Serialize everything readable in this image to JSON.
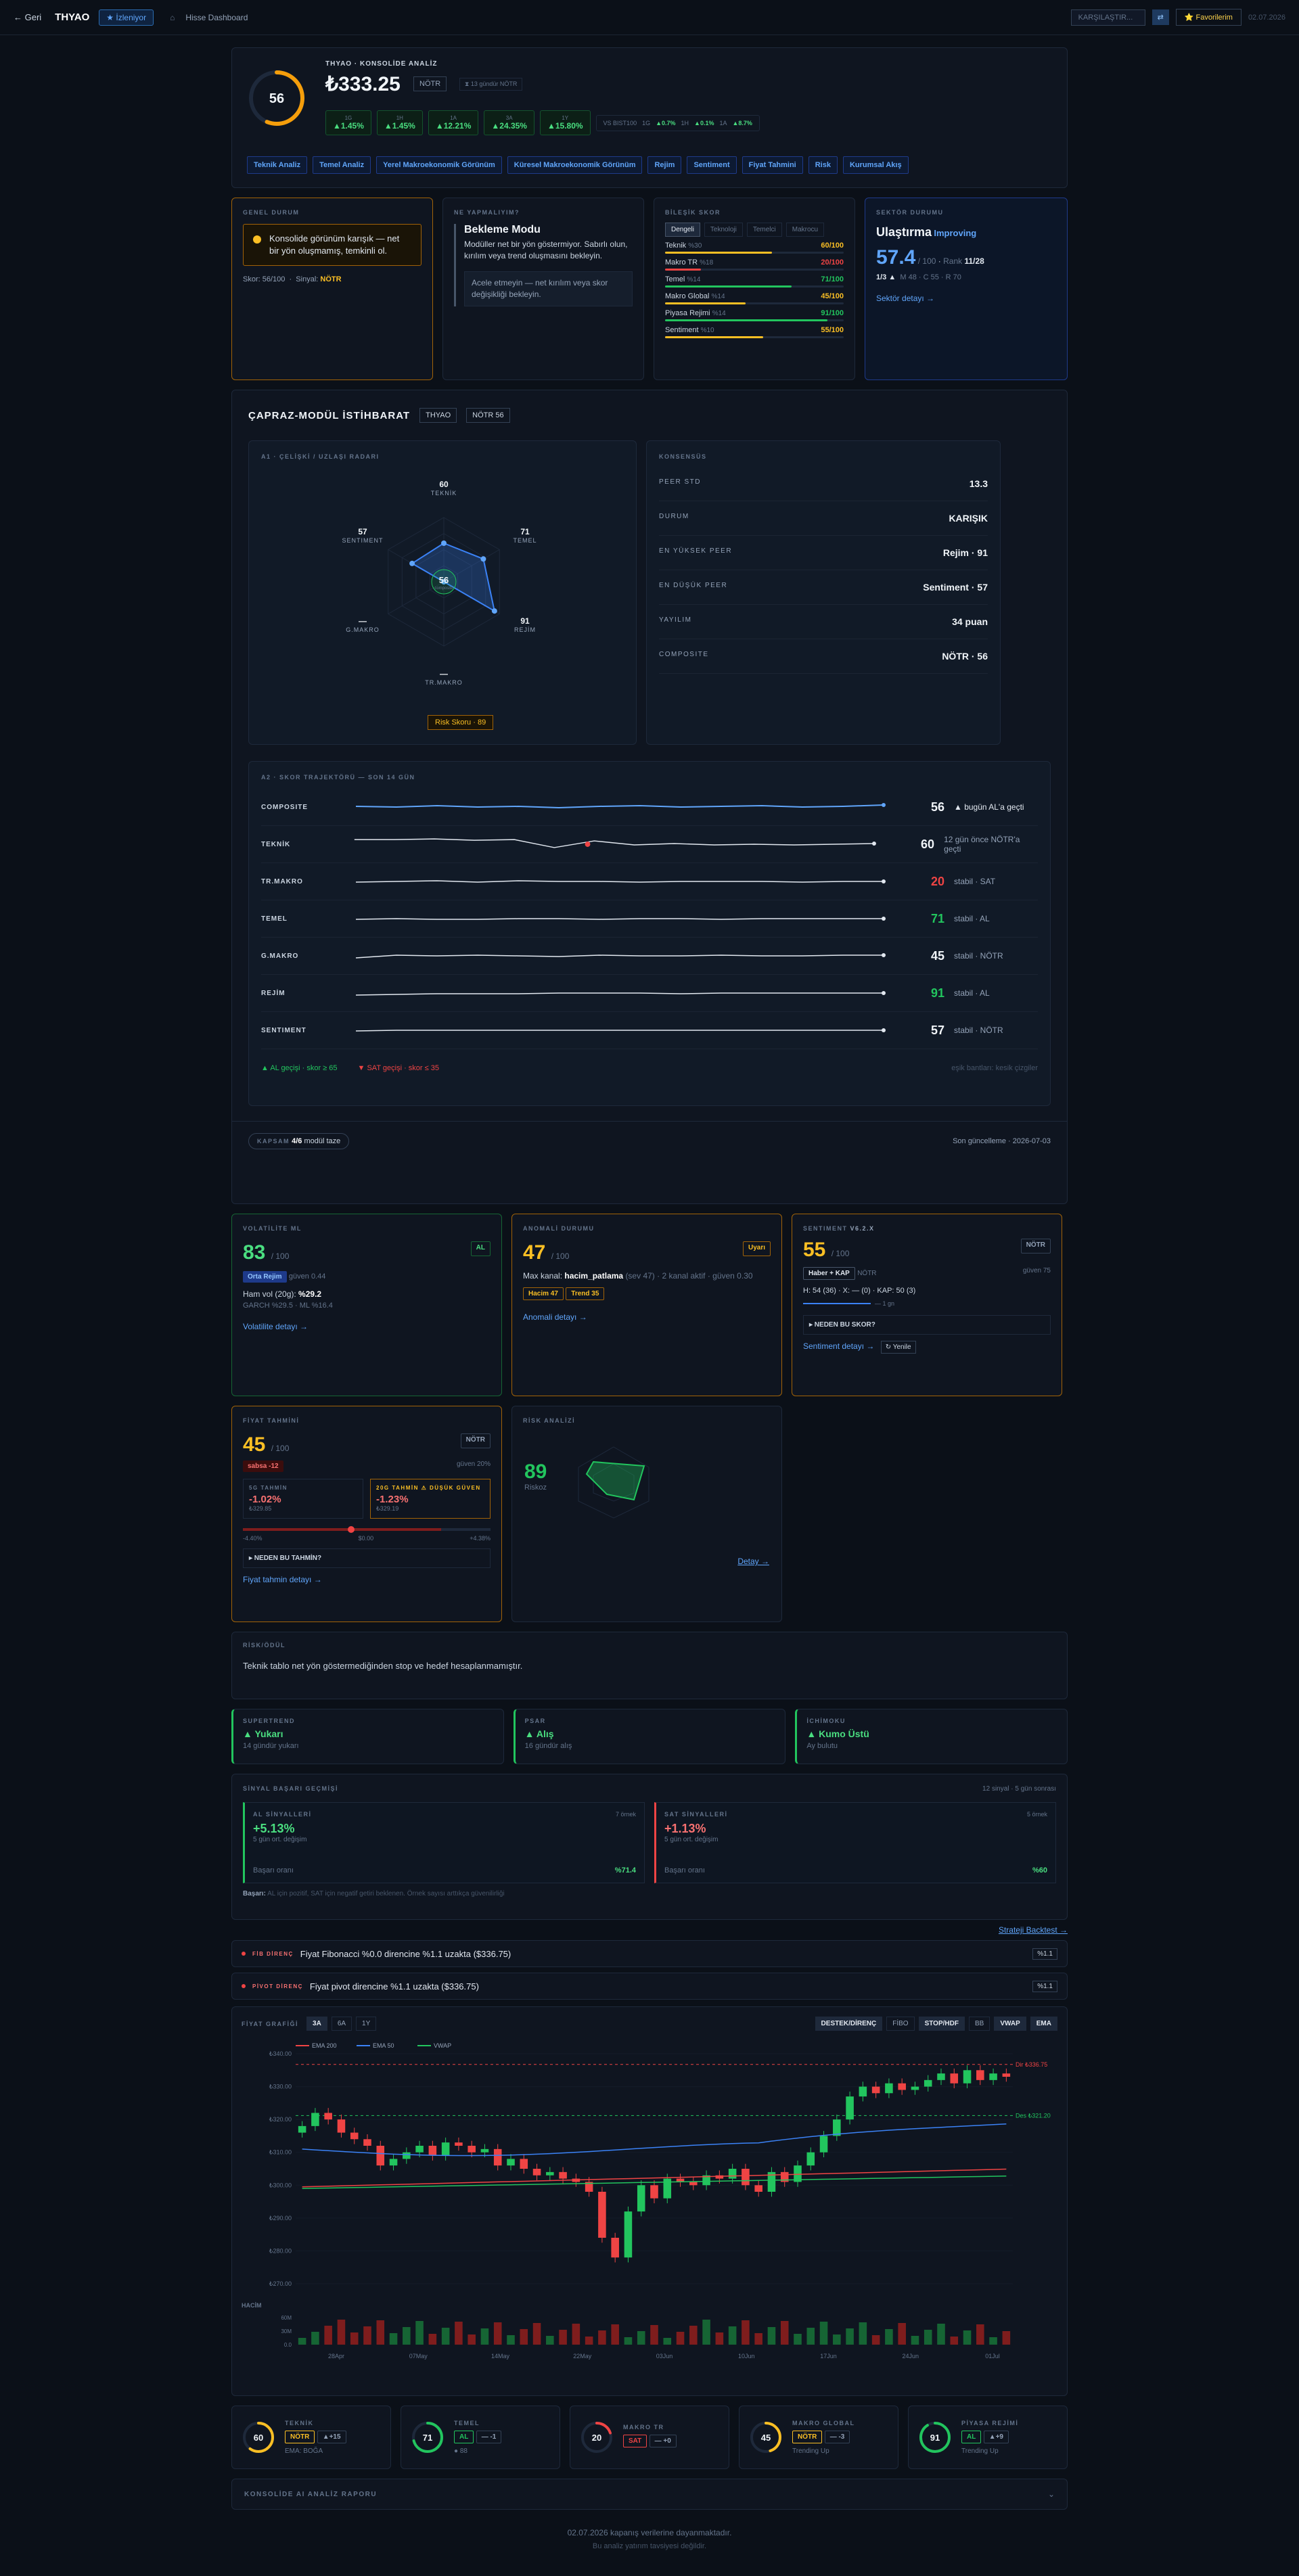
{
  "topbar": {
    "back": "← Geri",
    "symbol": "THYAO",
    "follow": "★ İzleniyor",
    "home": "⌂",
    "crumb": "Hisse Dashboard",
    "compare_placeholder": "KARŞILAŞTIR...",
    "compare_btn": "⇄",
    "fav": "⭐ Favorilerim",
    "date": "02.07.2026"
  },
  "hero": {
    "score": "56",
    "title": "THYAO · KONSOLİDE ANALİZ",
    "price": "₺333.25",
    "signal": "NÖTR",
    "since": "⧗ 13 gündür NÖTR",
    "changes": [
      {
        "k": "1G",
        "v": "▲1.45%"
      },
      {
        "k": "1H",
        "v": "▲1.45%"
      },
      {
        "k": "1A",
        "v": "▲12.21%"
      },
      {
        "k": "3A",
        "v": "▲24.35%"
      },
      {
        "k": "1Y",
        "v": "▲15.80%"
      }
    ],
    "vs_label": "VS BIST100",
    "vs": [
      {
        "k": "1G",
        "v": "▲0.7%"
      },
      {
        "k": "1H",
        "v": "▲0.1%"
      },
      {
        "k": "1A",
        "v": "▲8.7%"
      }
    ],
    "tabs": [
      "Teknik Analiz",
      "Temel Analiz",
      "Yerel Makroekonomik Görünüm",
      "Küresel Makroekonomik Görünüm",
      "Rejim",
      "Sentiment",
      "Fiyat Tahmini",
      "Risk",
      "Kurumsal Akış"
    ]
  },
  "general": {
    "label": "GENEL DURUM",
    "text": "Konsolide görünüm karışık — net bir yön oluşmamış, temkinli ol.",
    "score_k": "Skor:",
    "score_v": "56/100",
    "sig_k": "Sinyal:",
    "sig_v": "NÖTR"
  },
  "todo": {
    "label": "NE YAPMALIYIM?",
    "title": "Bekleme Modu",
    "body": "Modüller net bir yön göstermiyor. Sabırlı olun, kırılım veya trend oluşmasını bekleyin.",
    "note": "Acele etmeyin — net kırılım veya skor değişikliği bekleyin."
  },
  "composite": {
    "label": "BİLEŞİK SKOR",
    "tabs": [
      "Dengeli",
      "Teknoloji",
      "Temelci",
      "Makrocu"
    ],
    "bars": [
      {
        "n": "Teknik",
        "w": "%30",
        "v": "60/100",
        "c": "#fbbf24",
        "f": 0.6
      },
      {
        "n": "Makro TR",
        "w": "%18",
        "v": "20/100",
        "c": "#ef4444",
        "f": 0.2
      },
      {
        "n": "Temel",
        "w": "%14",
        "v": "71/100",
        "c": "#22c55e",
        "f": 0.71
      },
      {
        "n": "Makro Global",
        "w": "%14",
        "v": "45/100",
        "c": "#fbbf24",
        "f": 0.45
      },
      {
        "n": "Piyasa Rejimi",
        "w": "%14",
        "v": "91/100",
        "c": "#22c55e",
        "f": 0.91
      },
      {
        "n": "Sentiment",
        "w": "%10",
        "v": "55/100",
        "c": "#fbbf24",
        "f": 0.55
      }
    ]
  },
  "sector": {
    "label": "SEKTÖR DURUMU",
    "name": "Ulaştırma",
    "trend": "Improving",
    "score": "57.4",
    "of": "/ 100",
    "rank_k": "Rank",
    "rank": "11/28",
    "stat": "1/3 ▲",
    "meta": "M 48 · C 55 · R 70",
    "link": "Sektör detayı →"
  },
  "ci": {
    "title": "ÇAPRAZ-MODÜL İSTİHBARAT",
    "sym": "THYAO",
    "sig": "NÖTR 56",
    "radar": {
      "label": "A1 · ÇELİŞKİ / UZLAŞI RADARI",
      "center": "56",
      "center_sub": "composite",
      "risk": "Risk Skoru · 89",
      "axes": [
        {
          "n": "TEKNİK",
          "v": "60"
        },
        {
          "n": "TEMEL",
          "v": "71"
        },
        {
          "n": "REJİM",
          "v": "91"
        },
        {
          "n": "TR.MAKRO",
          "v": "—"
        },
        {
          "n": "G.MAKRO",
          "v": "—"
        },
        {
          "n": "SENTIMENT",
          "v": "57"
        }
      ]
    },
    "consensus": {
      "label": "KONSENSÜS",
      "rows": [
        {
          "k": "PEER STD",
          "v": "13.3"
        },
        {
          "k": "DURUM",
          "v": "KARIŞIK"
        },
        {
          "k": "EN YÜKSEK PEER",
          "v": "Rejim · 91"
        },
        {
          "k": "EN DÜŞÜK PEER",
          "v": "Sentiment · 57"
        },
        {
          "k": "YAYILIM",
          "v": "34 puan"
        },
        {
          "k": "COMPOSITE",
          "v": "NÖTR · 56"
        }
      ]
    },
    "traj": {
      "label": "A2 · SKOR TRAJEKTÖRÜ — SON 14 GÜN",
      "rows": [
        {
          "n": "COMPOSITE",
          "s": "56",
          "c": "#f1f5f9",
          "d": "▲ bugün AL'a geçti"
        },
        {
          "n": "TEKNİK",
          "s": "60",
          "c": "#f1f5f9",
          "d": "12 gün önce NÖTR'a geçti"
        },
        {
          "n": "TR.MAKRO",
          "s": "20",
          "c": "#ef4444",
          "d": "stabil · SAT"
        },
        {
          "n": "TEMEL",
          "s": "71",
          "c": "#22c55e",
          "d": "stabil · AL"
        },
        {
          "n": "G.MAKRO",
          "s": "45",
          "c": "#f1f5f9",
          "d": "stabil · NÖTR"
        },
        {
          "n": "REJİM",
          "s": "91",
          "c": "#22c55e",
          "d": "stabil · AL"
        },
        {
          "n": "SENTIMENT",
          "s": "57",
          "c": "#f1f5f9",
          "d": "stabil · NÖTR"
        }
      ],
      "leg_al": "▲ AL geçişi · skor ≥ 65",
      "leg_sat": "▼ SAT geçişi · skor ≤ 35",
      "leg_r": "eşik bantları: kesik çizgiler"
    },
    "cover_k": "KAPSAM",
    "cover_v": "4/6",
    "cover_s": "modül taze",
    "updated": "Son güncelleme · 2026-07-03"
  },
  "vol": {
    "label": "VOLATİLİTE ML",
    "score": "83",
    "of": "/ 100",
    "sig": "AL",
    "regime": "Orta Rejim",
    "conf": "güven 0.44",
    "hv_k": "Ham vol (20g):",
    "hv": "%29.2",
    "garch": "GARCH %29.5 · ML %16.4",
    "link": "Volatilite detayı →"
  },
  "anom": {
    "label": "ANOMALİ DURUMU",
    "score": "47",
    "of": "/ 100",
    "sig": "Uyarı",
    "text": "Max kanal:",
    "k": "hacim_patlama",
    "rest": "(sev 47) · 2 kanal aktif · güven 0.30",
    "t1": "Hacim 47",
    "t2": "Trend 35",
    "link": "Anomali detayı →"
  },
  "sent": {
    "label": "SENTIMENT",
    "ver": "V6.2.X",
    "score": "55",
    "of": "/ 100",
    "sig": "NÖTR",
    "src": "Haber + KAP",
    "src2": "NÖTR",
    "conf": "güven 75",
    "hx": "H: 54 (36) · X: — (0) · KAP: 50 (3)",
    "spark": "— 1 gn",
    "why": "▸ NEDEN BU SKOR?",
    "link": "Sentiment detayı →",
    "ref": "↻ Yenile"
  },
  "pred": {
    "label": "FİYAT TAHMİNİ",
    "score": "45",
    "of": "/ 100",
    "sig": "NÖTR",
    "warn": "sabsa -12",
    "conf": "güven 20%",
    "d5k": "5G TAHMİN",
    "d5": "-1.02%",
    "d5p": "₺329.85",
    "d20k": "20G TAHMİN",
    "d20w": "⚠ düşük güven",
    "d20": "-1.23%",
    "d20p": "₺329.19",
    "lo": "-4.40%",
    "mid": "$0.00",
    "hi": "+4.38%",
    "why": "▸ NEDEN BU TAHMİN?",
    "link": "Fiyat tahmin detayı →"
  },
  "risk": {
    "label": "RİSK ANALİZİ",
    "score": "89",
    "sub": "Riskoz",
    "link": "Detay →"
  },
  "rr": {
    "label": "RİSK/ÖDÜL",
    "text": "Teknik tablo net yön göstermediğinden stop ve hedef hesaplanmamıştır."
  },
  "sigs": [
    {
      "l": "SUPERTREND",
      "h": "▲ Yukarı",
      "s": "14 gündür yukarı"
    },
    {
      "l": "PSAR",
      "h": "▲ Alış",
      "s": "16 gündür alış"
    },
    {
      "l": "İCHİMOKU",
      "h": "▲ Kumo Üstü",
      "s": "Ay bulutu"
    }
  ],
  "hist": {
    "label": "SİNYAL BAŞARI GEÇMİŞİ",
    "right": "12 sinyal · 5 gün sonrası",
    "al": {
      "l": "AL SİNYALLERİ",
      "n": "7 örnek",
      "v": "+5.13%",
      "s": "5 gün ort. değişim",
      "rk": "Başarı oranı",
      "rv": "%71.4"
    },
    "sat": {
      "l": "SAT SİNYALLERİ",
      "n": "5 örnek",
      "v": "+1.13%",
      "s": "5 gün ort. değişim",
      "rk": "Başarı oranı",
      "rv": "%60"
    },
    "note_k": "Başarı:",
    "note": "AL için pozitif, SAT için negatif getiri beklenen. Örnek sayısı arttıkça güvenilirliği",
    "backtest": "Strateji Backtest →"
  },
  "alerts": [
    {
      "t": "FİB DİRENÇ",
      "m": "Fiyat Fibonacci %0.0 direncine %1.1 uzakta ($336.75)",
      "b": "%1.1"
    },
    {
      "t": "PİVOT DİRENÇ",
      "m": "Fiyat pivot direncine %1.1 uzakta ($336.75)",
      "b": "%1.1"
    }
  ],
  "chart": {
    "label": "FİYAT GRAFİĞİ",
    "ranges": [
      "3A",
      "6A",
      "1Y"
    ],
    "tools": [
      "DESTEK/DİRENÇ",
      "FİBO",
      "STOP/HDF",
      "BB",
      "VWAP",
      "EMA"
    ],
    "legend": [
      "EMA 200",
      "EMA 50",
      "VWAP"
    ],
    "res": "Dir ₺336.75",
    "sup": "Des ₺321.20",
    "vol": "HACİM",
    "vol_t": [
      "60M",
      "30M",
      "0.0"
    ],
    "yticks": [
      "₺340.00",
      "₺330.00",
      "₺320.00",
      "₺310.00",
      "₺300.00",
      "₺290.00",
      "₺280.00",
      "₺270.00"
    ],
    "xticks": [
      "28Apr",
      "07May",
      "14May",
      "22May",
      "03Jun",
      "10Jun",
      "17Jun",
      "24Jun",
      "01Jul"
    ]
  },
  "mods": [
    {
      "sc": "60",
      "c": "#fbbf24",
      "l": "TEKNİK",
      "b1": "NÖTR",
      "b2": "▲+15",
      "s": "EMA: BOĞA"
    },
    {
      "sc": "71",
      "c": "#22c55e",
      "l": "TEMEL",
      "b1": "AL",
      "b2": "— -1",
      "s": "● 88"
    },
    {
      "sc": "20",
      "c": "#ef4444",
      "l": "MAKRO TR",
      "b1": "SAT",
      "b2": "— +0",
      "s": ""
    },
    {
      "sc": "45",
      "c": "#fbbf24",
      "l": "MAKRO GLOBAL",
      "b1": "NÖTR",
      "b2": "— -3",
      "s": "Trending Up"
    },
    {
      "sc": "91",
      "c": "#22c55e",
      "l": "PİYASA REJİMİ",
      "b1": "AL",
      "b2": "▲+9",
      "s": "Trending Up"
    }
  ],
  "report": {
    "label": "KONSOLİDE AI ANALİZ RAPORU",
    "chev": "⌄"
  },
  "footer": {
    "l1": "02.07.2026 kapanış verilerine dayanmaktadır.",
    "l2": "Bu analiz yatırım tavsiyesi değildir."
  }
}
